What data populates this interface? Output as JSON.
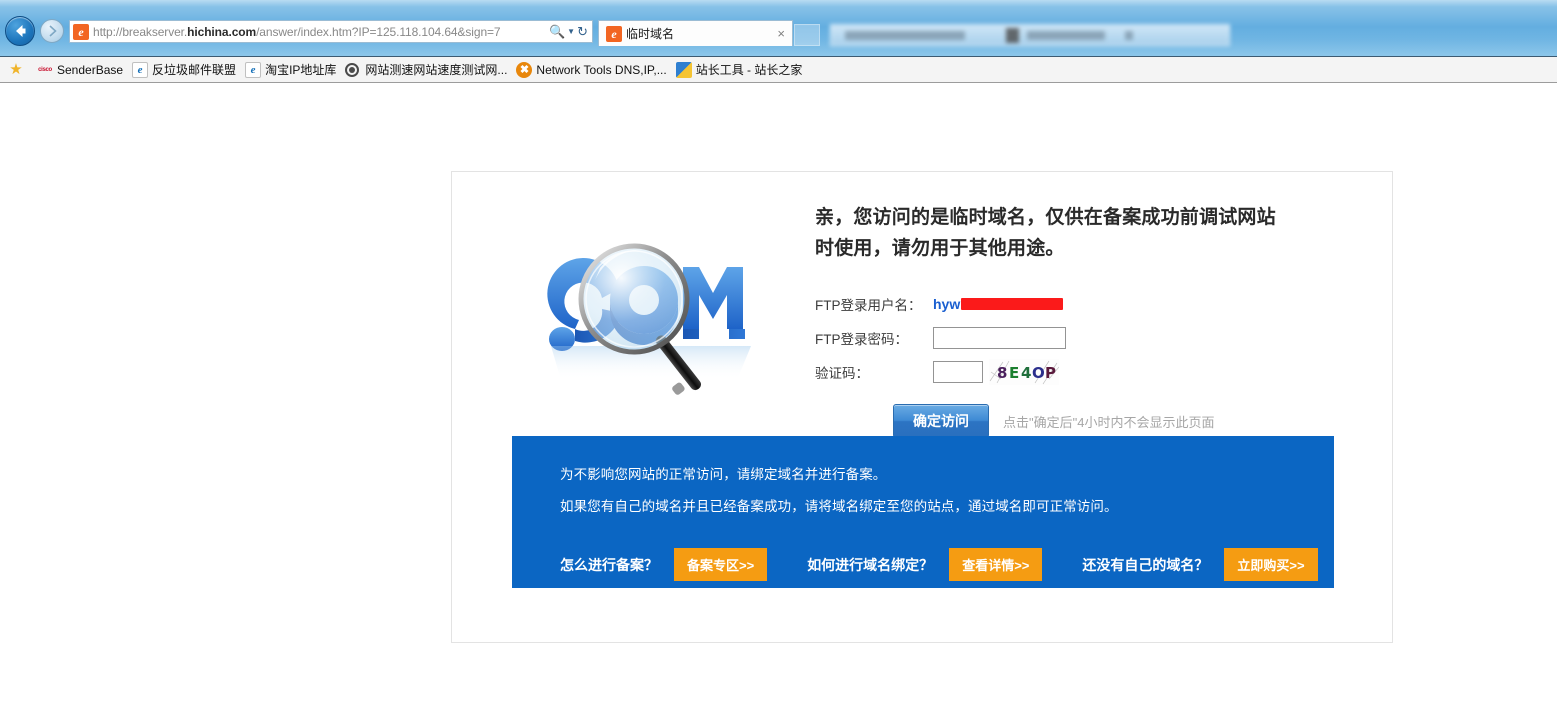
{
  "browser": {
    "back_label": "Back",
    "forward_label": "Forward",
    "url_prefix": "http://breakserver.",
    "url_domain": "hichina.com",
    "url_suffix": "/answer/index.htm?IP=125.118.104.64&sign=7",
    "search_icon": "search-icon",
    "dropdown_icon": "chevron-down-icon",
    "refresh_icon": "refresh-icon",
    "favicon_letter": "e",
    "tab": {
      "title": "临时域名",
      "close_label": "×",
      "favicon_letter": "e"
    },
    "new_tab_label": ""
  },
  "bookmarks": [
    {
      "label": "",
      "icon": "star-icon"
    },
    {
      "label": "SenderBase",
      "icon": "cisco-icon"
    },
    {
      "label": "反垃圾邮件联盟",
      "icon": "ie-icon"
    },
    {
      "label": "淘宝IP地址库",
      "icon": "ie-icon"
    },
    {
      "label": "网站测速网站速度测试网...",
      "icon": "target-icon"
    },
    {
      "label": "Network Tools DNS,IP,...",
      "icon": "orange-x-icon"
    },
    {
      "label": "站长工具 - 站长之家",
      "icon": "chinaz-icon"
    }
  ],
  "content": {
    "headline_line1": "亲，您访问的是临时域名，仅供在备案成功前调试网站",
    "headline_line2": "时使用，请勿用于其他用途。",
    "image_alt": "dot-com-magnifier-image",
    "form": {
      "username_label": "FTP登录用户名：",
      "username_value": "hyw",
      "username_redacted": true,
      "password_label": "FTP登录密码：",
      "password_value": "",
      "password_placeholder": "",
      "captcha_label": "验证码：",
      "captcha_value": "",
      "captcha_placeholder": "",
      "captcha_code": "8E4OP",
      "captcha_colors": [
        "#4a1f5c",
        "#1b7f2e",
        "#1f6f3c",
        "#2b2f8c",
        "#5a1a3c"
      ],
      "submit_label": "确定访问",
      "hint": "点击\"确定后\"4小时内不会显示此页面"
    },
    "banner": {
      "line1": "为不影响您网站的正常访问，请绑定域名并进行备案。",
      "line2": "如果您有自己的域名并且已经备案成功，请将域名绑定至您的站点，通过域名即可正常访问。",
      "ctas": [
        {
          "question": "怎么进行备案？",
          "button": "备案专区>>"
        },
        {
          "question": "如何进行域名绑定？",
          "button": "查看详情>>"
        },
        {
          "question": "还没有自己的域名？",
          "button": "立即购买>>"
        }
      ]
    }
  },
  "colors": {
    "banner_blue": "#0b66c3",
    "cta_orange": "#f59c12",
    "primary_button": "#2c74c3",
    "link_blue": "#1a5fd0",
    "redaction_red": "#fb1a1a"
  }
}
